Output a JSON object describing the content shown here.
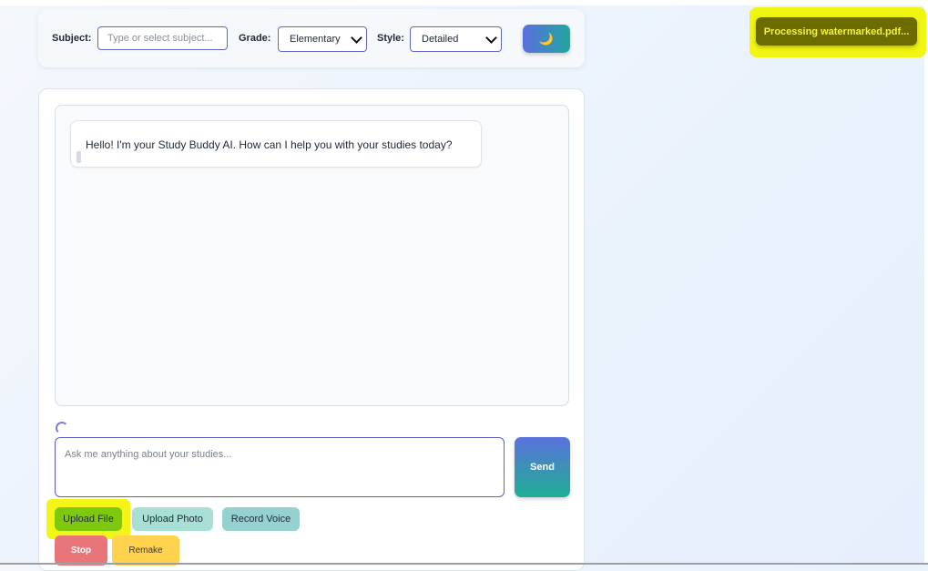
{
  "controls": {
    "subject_label": "Subject:",
    "subject_placeholder": "Type or select subject...",
    "grade_label": "Grade:",
    "grade_value": "Elementary",
    "style_label": "Style:",
    "style_value": "Detailed",
    "theme_icon": "moon-icon",
    "theme_glyph": "🌙"
  },
  "chat": {
    "messages": [
      {
        "role": "assistant",
        "text": "Hello! I'm your Study Buddy AI. How can I help you with your studies today?"
      }
    ]
  },
  "composer": {
    "placeholder": "Ask me anything about your studies...",
    "send_label": "Send"
  },
  "actions": {
    "upload_file": "Upload File",
    "upload_photo": "Upload Photo",
    "record_voice": "Record Voice",
    "stop": "Stop",
    "remake": "Remake"
  },
  "toast": {
    "text": "Processing watermarked.pdf..."
  },
  "colors": {
    "accent": "#5b6fde",
    "highlight": "#f1f512",
    "toast_bg": "#6b6b00",
    "stop": "#e8757a",
    "remake": "#ffd34d"
  }
}
